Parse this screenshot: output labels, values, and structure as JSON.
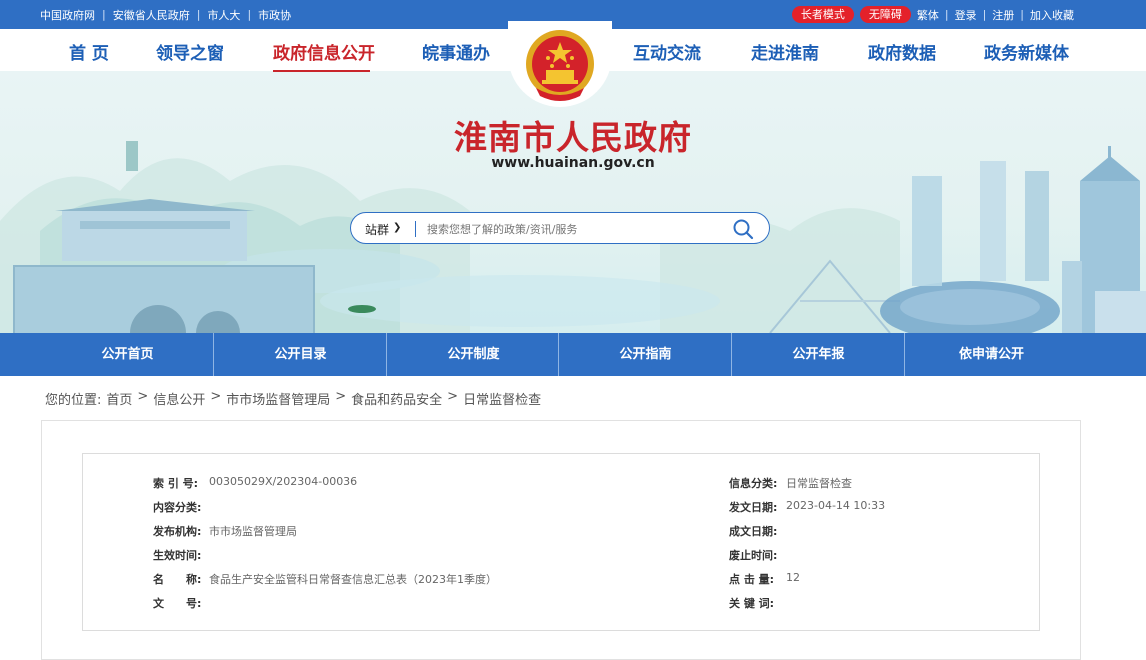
{
  "topbar": {
    "left_links": [
      "中国政府网",
      "安徽省人民政府",
      "市人大",
      "市政协"
    ],
    "elder_mode": "长者模式",
    "accessible": "无障碍",
    "right_links": [
      "繁体",
      "登录",
      "注册",
      "加入收藏"
    ]
  },
  "nav": {
    "items": [
      "首 页",
      "领导之窗",
      "政府信息公开",
      "皖事通办",
      "互动交流",
      "走进淮南",
      "政府数据",
      "政务新媒体"
    ],
    "active_index": 2
  },
  "banner": {
    "title": "淮南市人民政府",
    "url": "www.huainan.gov.cn"
  },
  "search": {
    "scope": "站群",
    "placeholder": "搜索您想了解的政策/资讯/服务"
  },
  "subnav": {
    "items": [
      "公开首页",
      "公开目录",
      "公开制度",
      "公开指南",
      "公开年报",
      "依申请公开"
    ]
  },
  "breadcrumb": {
    "prefix": "您的位置:",
    "items": [
      "首页",
      "信息公开",
      "市市场监督管理局",
      "食品和药品安全",
      "日常监督检查"
    ]
  },
  "info": {
    "index_no_label": "索 引 号:",
    "index_no": "00305029X/202304-00036",
    "category_label": "信息分类:",
    "category": "日常监督检查",
    "content_type_label": "内容分类:",
    "content_type": "",
    "publish_date_label": "发文日期:",
    "publish_date": "2023-04-14 10:33",
    "org_label": "发布机构:",
    "org": "市市场监督管理局",
    "created_label": "成文日期:",
    "created": "",
    "effective_label": "生效时间:",
    "effective": "",
    "expire_label": "废止时间:",
    "expire": "",
    "name_label": "名　　称:",
    "name": "食品生产安全监管科日常督查信息汇总表（2023年1季度）",
    "clicks_label": "点 击 量:",
    "clicks": "12",
    "doc_no_label": "文　　号:",
    "doc_no": "",
    "keywords_label": "关 键 词:",
    "keywords": ""
  },
  "colors": {
    "primary_blue": "#2f6fc4",
    "accent_red": "#c9252b",
    "pill_red": "#e4212a"
  }
}
